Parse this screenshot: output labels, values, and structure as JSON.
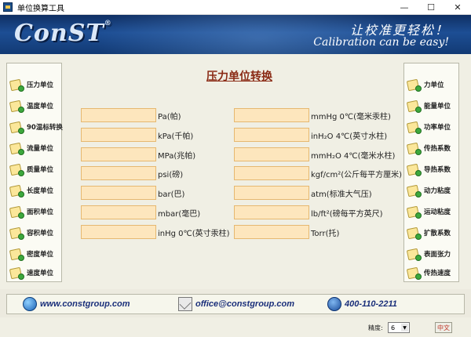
{
  "window": {
    "title": "单位换算工具",
    "controls": [
      "—",
      "☐",
      "✕"
    ]
  },
  "banner": {
    "logo": "ConST",
    "logo_mark": "®",
    "slogan_cn": "让校准更轻松！",
    "slogan_en": "Calibration can be easy!"
  },
  "left_menu": [
    {
      "label": "压力单位"
    },
    {
      "label": "温度单位"
    },
    {
      "label": "90温标转换"
    },
    {
      "label": "流量单位"
    },
    {
      "label": "质量单位"
    },
    {
      "label": "长度单位"
    },
    {
      "label": "面积单位"
    },
    {
      "label": "容积单位"
    },
    {
      "label": "密度单位"
    },
    {
      "label": "速度单位"
    }
  ],
  "right_menu": [
    {
      "label": "力单位"
    },
    {
      "label": "能量单位"
    },
    {
      "label": "功率单位"
    },
    {
      "label": "传热系数"
    },
    {
      "label": "导热系数"
    },
    {
      "label": "动力粘度"
    },
    {
      "label": "运动粘度"
    },
    {
      "label": "扩散系数"
    },
    {
      "label": "表面张力"
    },
    {
      "label": "传热速度"
    }
  ],
  "converter": {
    "title": "压力单位转换",
    "left_units": [
      {
        "label": "Pa(帕)",
        "value": ""
      },
      {
        "label": "kPa(千帕)",
        "value": ""
      },
      {
        "label": "MPa(兆帕)",
        "value": ""
      },
      {
        "label": "psi(磅)",
        "value": ""
      },
      {
        "label": "bar(巴)",
        "value": ""
      },
      {
        "label": "mbar(毫巴)",
        "value": ""
      },
      {
        "label": "inHg 0℃(英寸汞柱)",
        "value": ""
      }
    ],
    "right_units": [
      {
        "label": "mmHg 0℃(毫米汞柱)",
        "value": ""
      },
      {
        "label": "inH₂O 4℃(英寸水柱)",
        "value": ""
      },
      {
        "label": "mmH₂O 4℃(毫米水柱)",
        "value": ""
      },
      {
        "label": "kgf/cm²(公斤每平方厘米)",
        "value": ""
      },
      {
        "label": "atm(标准大气压)",
        "value": ""
      },
      {
        "label": "lb/ft²(磅每平方英尺)",
        "value": ""
      },
      {
        "label": "Torr(托)",
        "value": ""
      }
    ]
  },
  "footer": {
    "website": "www.constgroup.com",
    "email": "office@constgroup.com",
    "phone": "400-110-2211"
  },
  "status": {
    "precision_label": "精度:",
    "precision_value": "6",
    "language": "中文"
  }
}
